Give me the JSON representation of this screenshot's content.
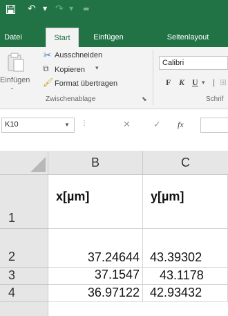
{
  "quick_access": {
    "save_icon": "save-icon",
    "undo_icon": "undo-icon",
    "redo_icon": "redo-icon",
    "customize_icon": "customize-qat-icon"
  },
  "tabs": [
    {
      "label": "Datei"
    },
    {
      "label": "Start"
    },
    {
      "label": "Einfügen"
    },
    {
      "label": "Seitenlayout"
    }
  ],
  "ribbon": {
    "clipboard": {
      "paste_label": "Einfügen",
      "cut_label": "Ausschneiden",
      "copy_label": "Kopieren",
      "format_painter_label": "Format übertragen",
      "group_label": "Zwischenablage"
    },
    "font": {
      "font_name": "Calibri",
      "bold": "F",
      "italic": "K",
      "underline": "U",
      "group_label": "Schrif"
    }
  },
  "formula_bar": {
    "name_box": "K10",
    "fx_label": "fx"
  },
  "sheet": {
    "columns": [
      "B",
      "C"
    ],
    "rows": [
      {
        "number": "1",
        "B": "x[µm]",
        "C": "y[µm]"
      },
      {
        "number": "2",
        "B": "37.24644",
        "C": "43.39302"
      },
      {
        "number": "3",
        "B": "37.1547",
        "C": "43.1178"
      },
      {
        "number": "4",
        "B": "36.97122",
        "C": "42.93432"
      }
    ]
  },
  "colors": {
    "accent": "#217346"
  }
}
